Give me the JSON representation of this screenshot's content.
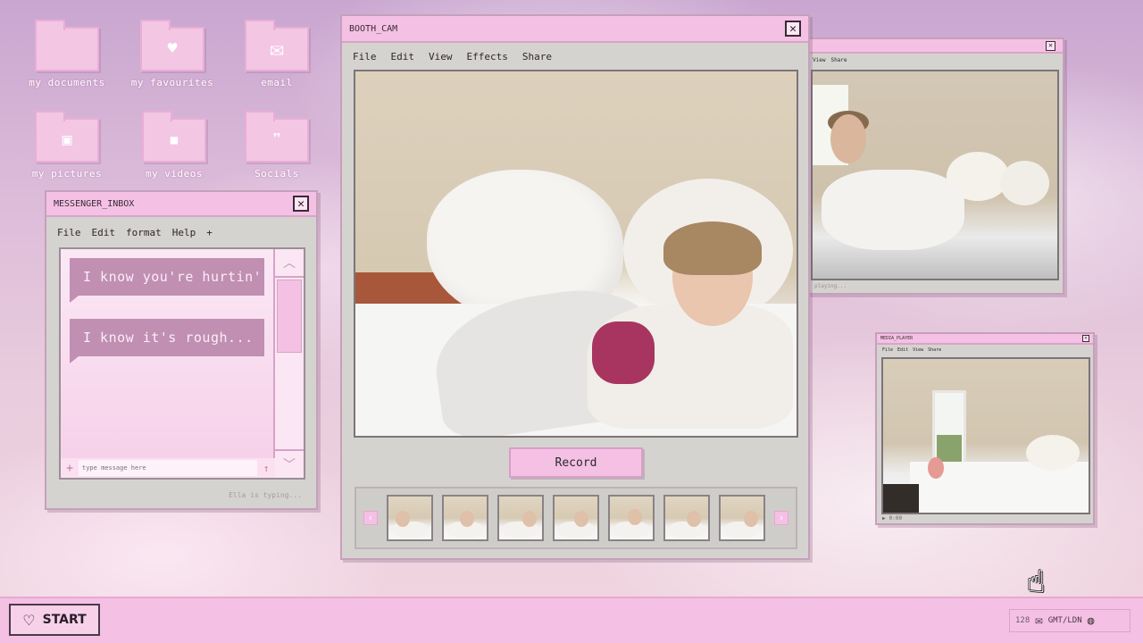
{
  "desktop": {
    "icons": [
      {
        "label": "my documents",
        "glyph": ""
      },
      {
        "label": "my favourites",
        "glyph": "♥"
      },
      {
        "label": "email",
        "glyph": "✉"
      },
      {
        "label": "my pictures",
        "glyph": "▣"
      },
      {
        "label": "my videos",
        "glyph": "■"
      },
      {
        "label": "Socials",
        "glyph": "❞"
      }
    ]
  },
  "booth": {
    "title": "BOOTH_CAM",
    "menu": [
      "File",
      "Edit",
      "View",
      "Effects",
      "Share"
    ],
    "record_label": "Record",
    "prev": "‹",
    "next": "›"
  },
  "messenger": {
    "title": "MESSENGER_INBOX",
    "menu": [
      "File",
      "Edit",
      "format",
      "Help",
      "+"
    ],
    "messages": [
      "I know you're hurtin'",
      "I know it's rough..."
    ],
    "input_placeholder": "type message here",
    "status": "Ella is typing...",
    "plus": "+",
    "send": "↑",
    "scroll_up": "︿",
    "scroll_down": "﹀"
  },
  "video_window": {
    "menu": [
      "View",
      "Share"
    ],
    "footer": "playing..."
  },
  "media_player": {
    "title": "MEDIA_PLAYER",
    "menu": [
      "File",
      "Edit",
      "View",
      "Share"
    ],
    "footer": "0:00"
  },
  "taskbar": {
    "start_label": "START",
    "tray_count": "128",
    "tray_tz": "GMT/LDN"
  },
  "colors": {
    "accent_pink": "#f4c1e4",
    "bubble": "#c08fb2",
    "window_gray": "#d5d3d0"
  }
}
